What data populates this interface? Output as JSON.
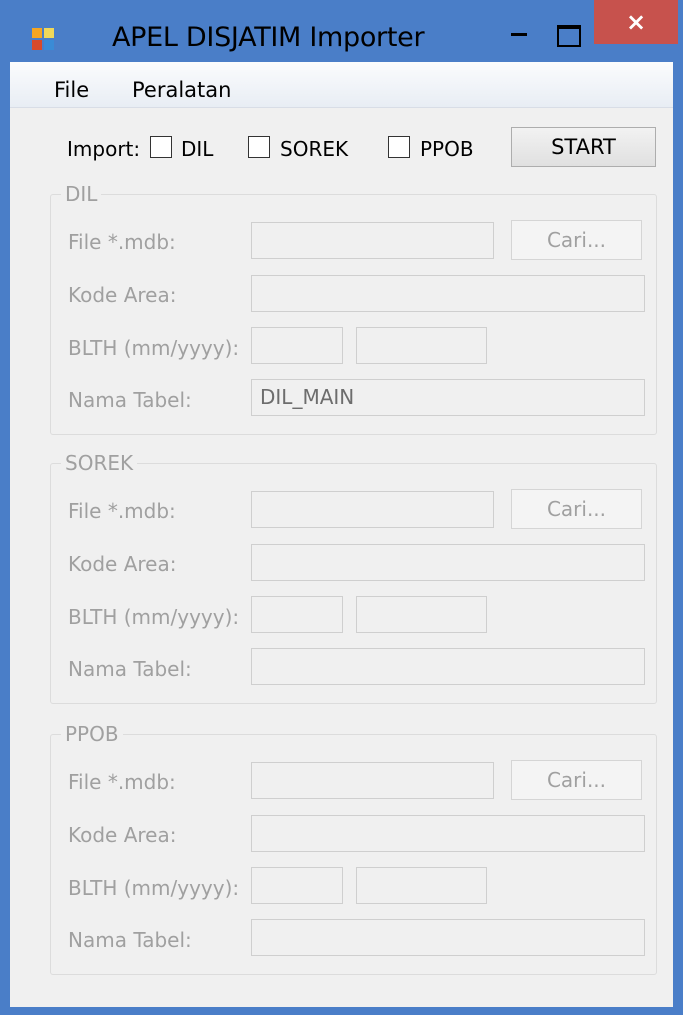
{
  "window": {
    "title": "APEL DISJATIM Importer",
    "close_glyph": "×"
  },
  "menu": {
    "file": "File",
    "peralatan": "Peralatan"
  },
  "import_bar": {
    "label": "Import:",
    "options": [
      {
        "label": "DIL",
        "checked": false
      },
      {
        "label": "SOREK",
        "checked": false
      },
      {
        "label": "PPOB",
        "checked": false
      }
    ],
    "start_label": "START"
  },
  "groups": [
    {
      "title": "DIL",
      "file_label": "File *.mdb:",
      "file_value": "",
      "cari_label": "Cari...",
      "kode_label": "Kode Area:",
      "kode_value": "",
      "blth_label": "BLTH (mm/yyyy):",
      "blth_month": "",
      "blth_year": "",
      "nama_label": "Nama Tabel:",
      "nama_value": "DIL_MAIN"
    },
    {
      "title": "SOREK",
      "file_label": "File *.mdb:",
      "file_value": "",
      "cari_label": "Cari...",
      "kode_label": "Kode Area:",
      "kode_value": "",
      "blth_label": "BLTH (mm/yyyy):",
      "blth_month": "",
      "blth_year": "",
      "nama_label": "Nama Tabel:",
      "nama_value": ""
    },
    {
      "title": "PPOB",
      "file_label": "File *.mdb:",
      "file_value": "",
      "cari_label": "Cari...",
      "kode_label": "Kode Area:",
      "kode_value": "",
      "blth_label": "BLTH (mm/yyyy):",
      "blth_month": "",
      "blth_year": "",
      "nama_label": "Nama Tabel:",
      "nama_value": ""
    }
  ],
  "colors": {
    "titlebar": "#4a7ec8",
    "close_button": "#c7524d",
    "client_bg": "#f0f0f0",
    "disabled_text": "#a0a0a0"
  }
}
